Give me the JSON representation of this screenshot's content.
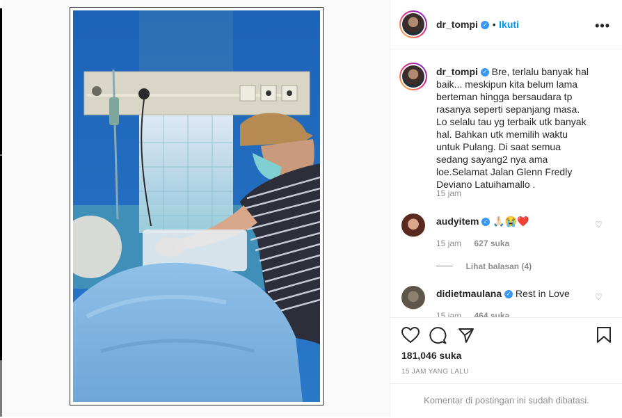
{
  "post": {
    "author": "dr_tompi",
    "follow_separator": "•",
    "follow_label": "Ikuti",
    "more_label": "•••",
    "caption_author": "dr_tompi",
    "caption_text": "Bre, terlalu banyak hal baik... meskipun kita belum lama berteman hingga bersaudara tp rasanya seperti sepanjang masa. Lo selalu tau yg terbaik utk banyak hal. Bahkan utk memilih waktu untuk Pulang. Di saat semua sedang sayang2 nya ama loe.Selamat Jalan Glenn Fredly Deviano Latuihamallo .",
    "caption_time": "15 jam",
    "likes": "181,046 suka",
    "date": "15 JAM YANG LALU",
    "comments_closed": "Komentar di postingan ini sudah dibatasi."
  },
  "comments": [
    {
      "username": "audyitem",
      "text": "🙏🏻😭❤️",
      "time": "15 jam",
      "likes": "627 suka",
      "replies": "Lihat balasan (4)"
    },
    {
      "username": "didietmaulana",
      "text": "Rest in Love",
      "time": "15 jam",
      "likes": "464 suka"
    }
  ],
  "icons": {
    "verified": "✓",
    "heart": "♡"
  },
  "colors": {
    "link": "#0095f6",
    "verified": "#3897f0",
    "muted": "#8e8e8e"
  }
}
